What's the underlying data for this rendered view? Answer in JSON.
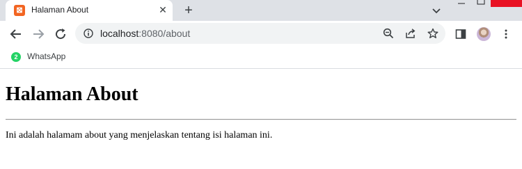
{
  "tab": {
    "title": "Halaman About",
    "favicon": "xampp-favicon",
    "close_label": "✕"
  },
  "new_tab_label": "+",
  "address": {
    "host": "localhost",
    "rest": ":8080/about"
  },
  "bookmarks": [
    {
      "label": "WhatsApp",
      "badge": "2",
      "icon": "whatsapp-icon"
    }
  ],
  "page": {
    "heading": "Halaman About",
    "paragraph": "Ini adalah halamam about yang menjelaskan tentang isi halaman ini."
  },
  "colors": {
    "tabstrip": "#dee1e6",
    "favicon": "#f26522",
    "whatsapp": "#25d366",
    "window_close": "#e81123"
  }
}
